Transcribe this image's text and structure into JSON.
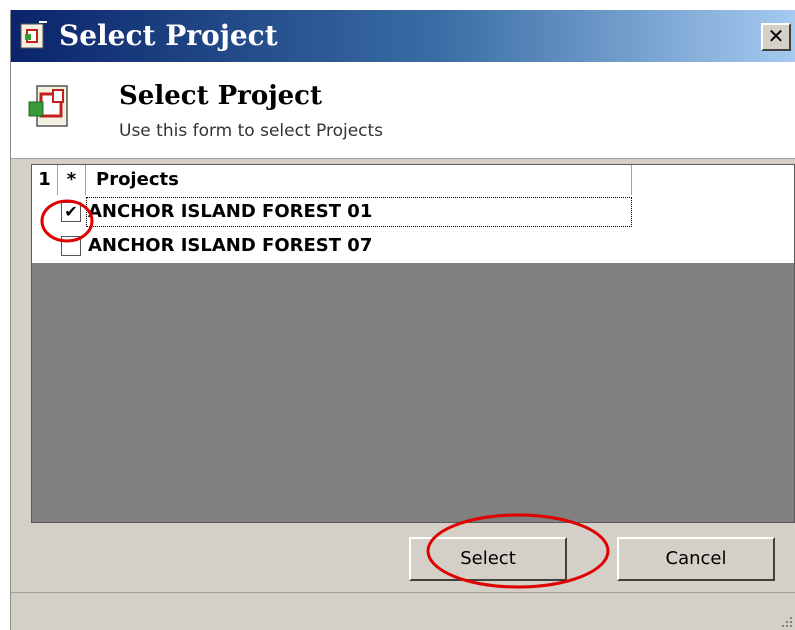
{
  "window": {
    "title": "Select Project"
  },
  "header": {
    "title": "Select Project",
    "subtitle": "Use this form to select Projects"
  },
  "grid": {
    "columns": [
      "1",
      "*",
      "Projects",
      ""
    ],
    "rows": [
      {
        "checked": true,
        "check_glyph": "✔",
        "name": "ANCHOR ISLAND FOREST 01"
      },
      {
        "checked": false,
        "check_glyph": "",
        "name": "ANCHOR ISLAND FOREST 07"
      }
    ]
  },
  "buttons": {
    "select": "Select",
    "cancel": "Cancel"
  },
  "close_glyph": "✕",
  "colors": {
    "title_gradient_start": "#0a246a",
    "title_gradient_end": "#a6caf0",
    "grid_empty_area": "#808080",
    "annotation": "#e00000"
  }
}
